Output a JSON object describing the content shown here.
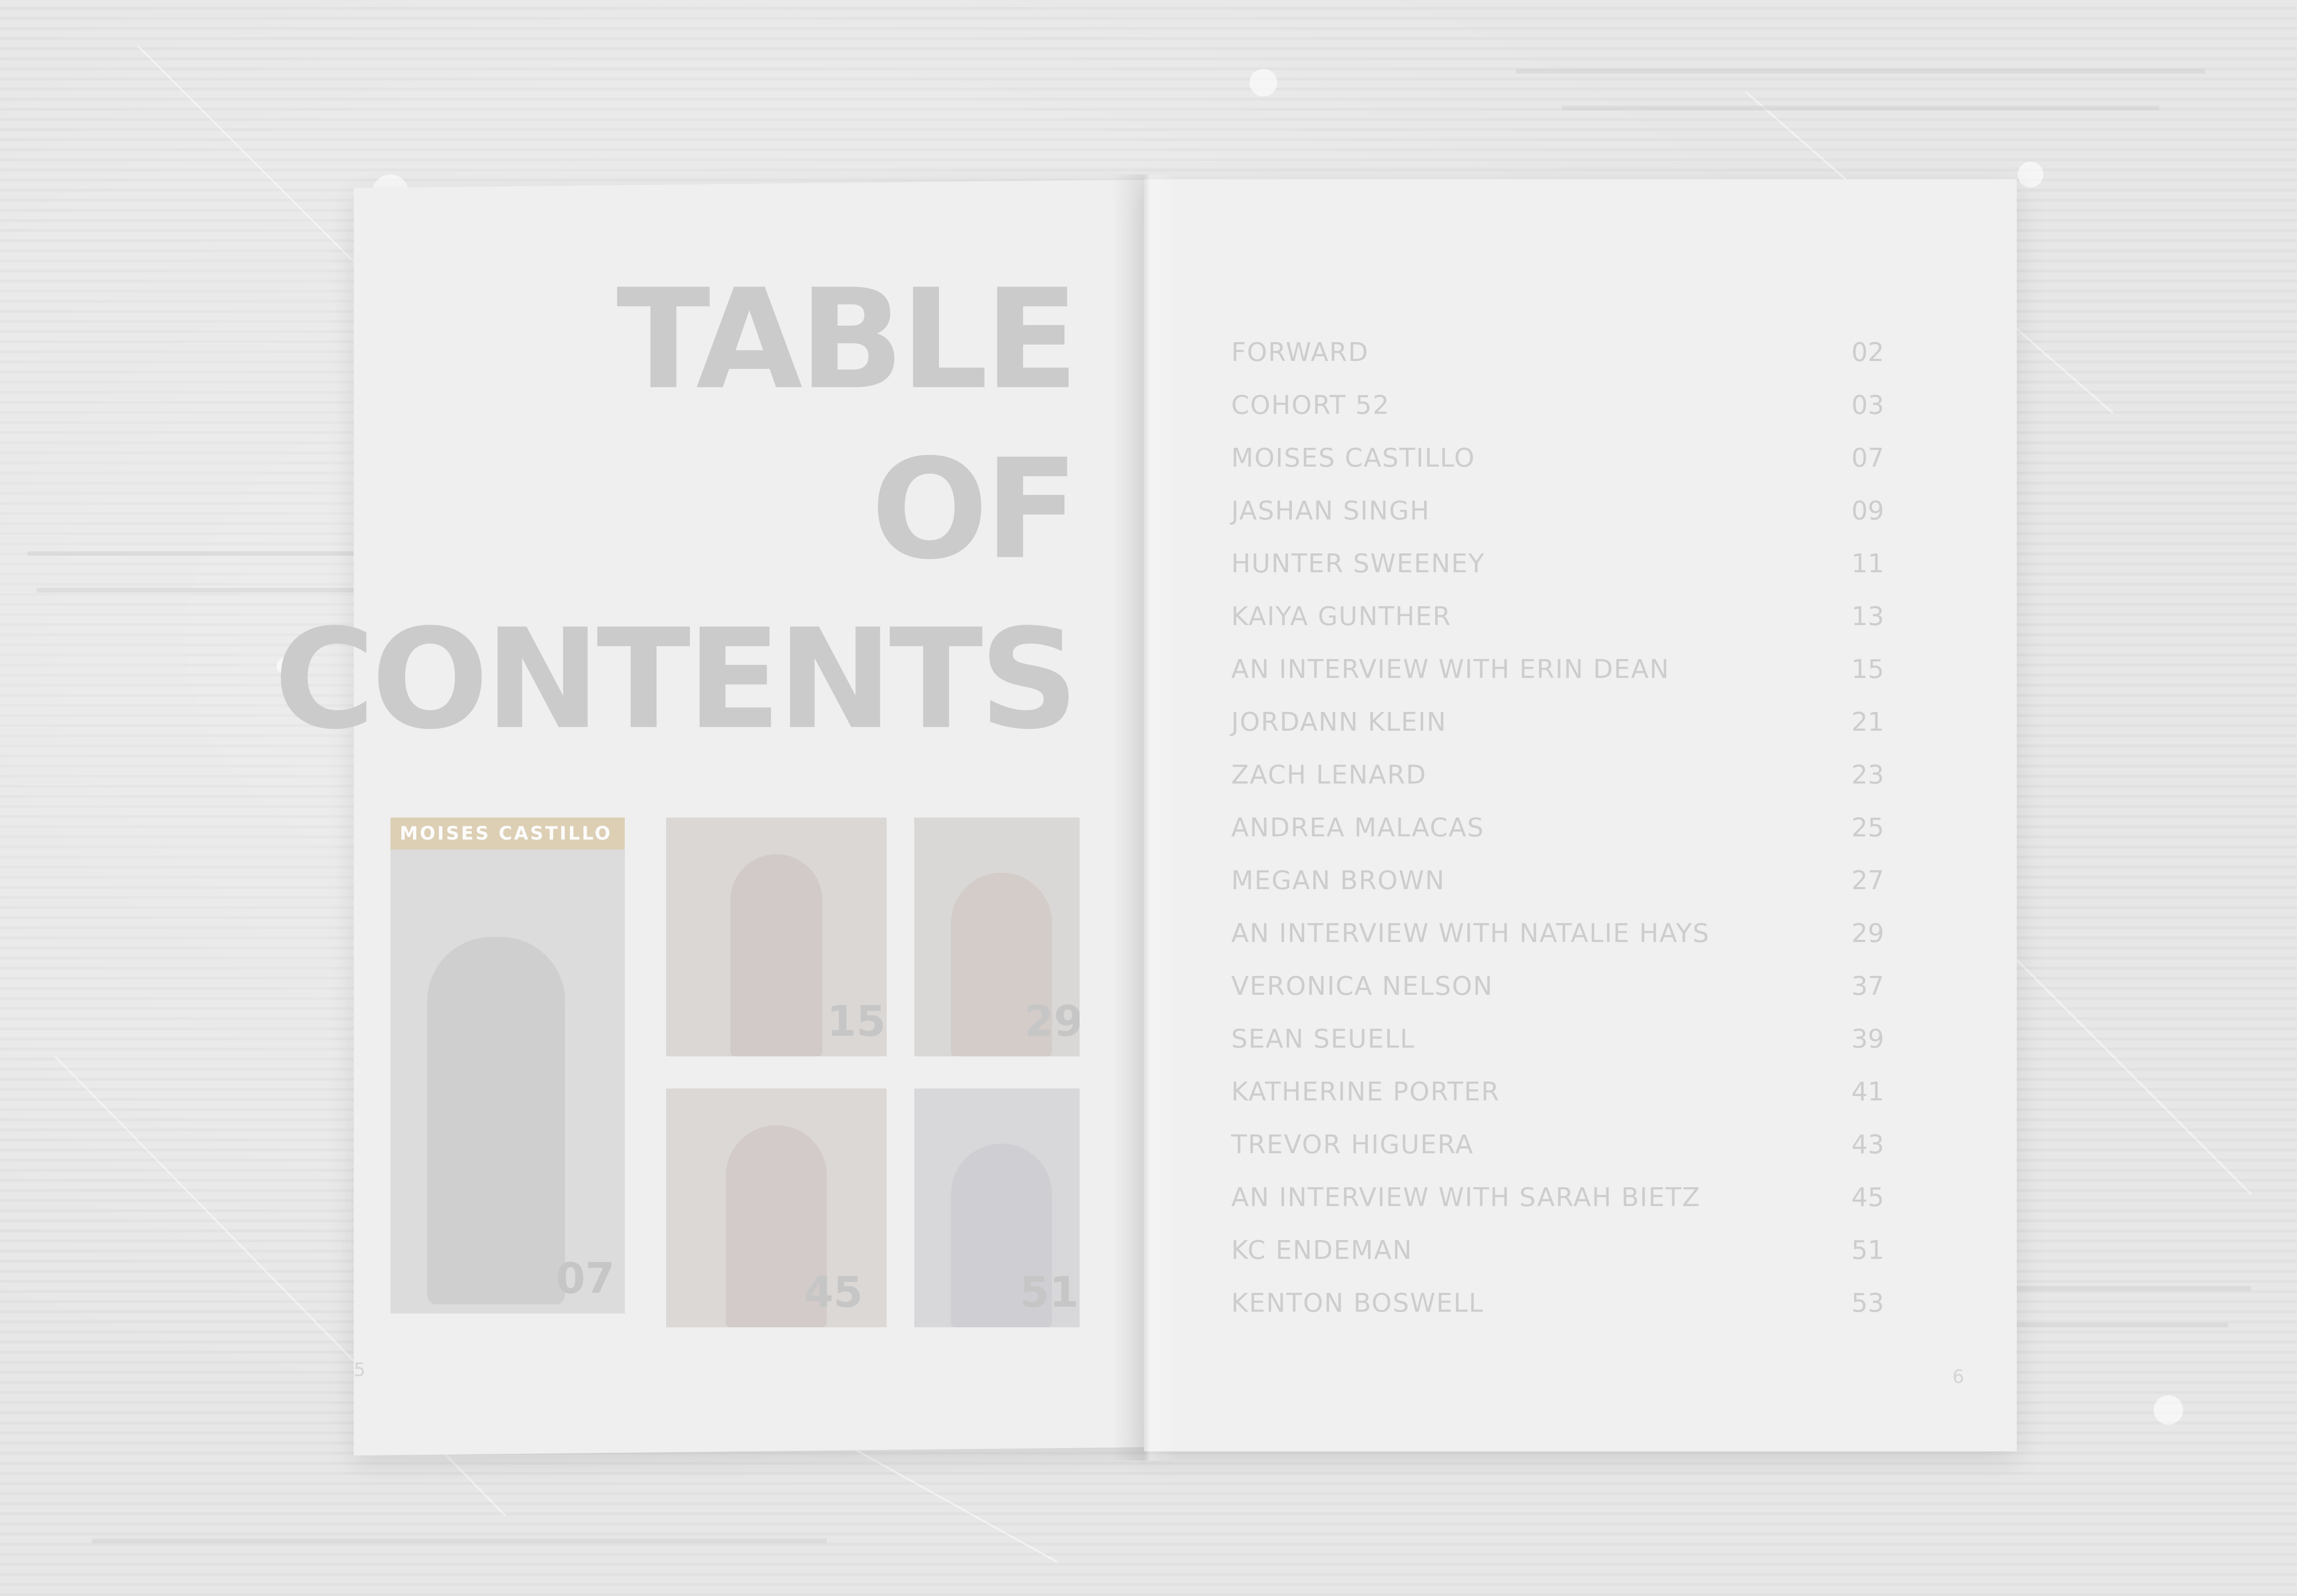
{
  "title": {
    "line1": "TABLE",
    "line2": "OF",
    "line3": "CONTENTS"
  },
  "thumbnails": [
    {
      "number": "07",
      "banner": "MOISES CASTILLO"
    },
    {
      "number": "15"
    },
    {
      "number": "29"
    },
    {
      "number": "45"
    },
    {
      "number": "51"
    }
  ],
  "toc": [
    {
      "title": "FORWARD",
      "page": "02"
    },
    {
      "title": "COHORT 52",
      "page": "03"
    },
    {
      "title": "MOISES CASTILLO",
      "page": "07"
    },
    {
      "title": "JASHAN SINGH",
      "page": "09"
    },
    {
      "title": "HUNTER SWEENEY",
      "page": "11"
    },
    {
      "title": "KAIYA GUNTHER",
      "page": "13"
    },
    {
      "title": "AN INTERVIEW WITH ERIN DEAN",
      "page": "15"
    },
    {
      "title": "JORDANN KLEIN",
      "page": "21"
    },
    {
      "title": "ZACH LENARD",
      "page": "23"
    },
    {
      "title": "ANDREA MALACAS",
      "page": "25"
    },
    {
      "title": "MEGAN BROWN",
      "page": "27"
    },
    {
      "title": "AN INTERVIEW WITH NATALIE HAYS",
      "page": "29"
    },
    {
      "title": "VERONICA NELSON",
      "page": "37"
    },
    {
      "title": "SEAN SEUELL",
      "page": "39"
    },
    {
      "title": "KATHERINE PORTER",
      "page": "41"
    },
    {
      "title": "TREVOR HIGUERA",
      "page": "43"
    },
    {
      "title": "AN INTERVIEW WITH SARAH BIETZ",
      "page": "45"
    },
    {
      "title": "KC ENDEMAN",
      "page": "51"
    },
    {
      "title": "KENTON BOSWELL",
      "page": "53"
    }
  ],
  "folios": {
    "left": "5",
    "right": "6"
  },
  "colors": {
    "background": "#e6e6e6",
    "page": "#f0f0f0",
    "ink": "#c4c4c4"
  }
}
